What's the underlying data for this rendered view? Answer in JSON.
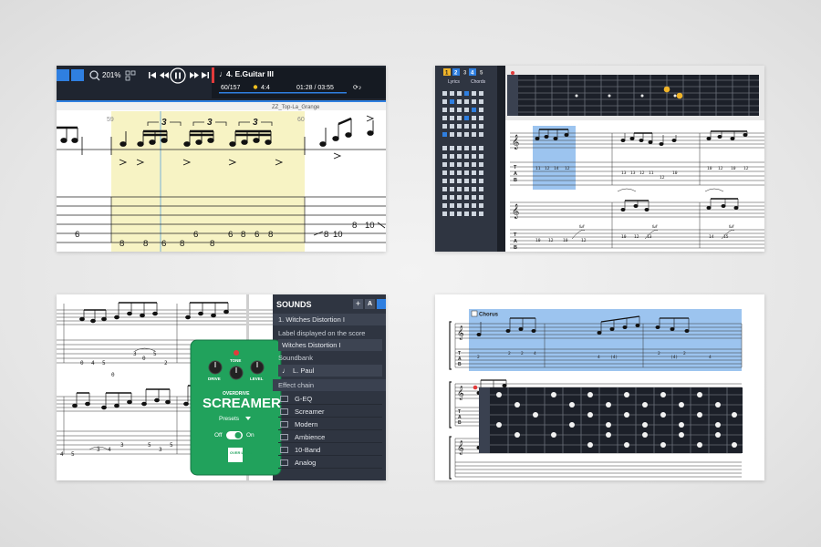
{
  "panel1": {
    "zoom": "201%",
    "track_name": "4. E.Guitar III",
    "bar_position": "60/157",
    "time_signature": "4:4",
    "time": "01:28 / 03:55",
    "song_title": "ZZ_Top-La_Grange",
    "bar_numbers": [
      "59",
      "60"
    ],
    "triplet_marks": [
      "3",
      "3",
      "3"
    ],
    "tab_numbers": [
      "6",
      "8",
      "8",
      "6",
      "8",
      "6",
      "8",
      "6",
      "8",
      "6",
      "8",
      "8",
      "10",
      "8",
      "10"
    ]
  },
  "panel2": {
    "palette_tabs": [
      "1",
      "2",
      "3",
      "4",
      "5"
    ],
    "lyrics_label": "Lyrics",
    "chords_label": "Chords",
    "tab_clef": [
      "T",
      "A",
      "B"
    ],
    "fret_row_1": [
      "11",
      "12",
      "14",
      "12",
      "13",
      "13",
      "12",
      "11",
      "12",
      "10",
      "10",
      "12",
      "10",
      "12"
    ],
    "fret_row_2": [
      "10",
      "12",
      "10",
      "12",
      "10",
      "12",
      "13",
      "14",
      "15"
    ],
    "bend_labels": [
      "full",
      "full",
      "full"
    ]
  },
  "panel3": {
    "sounds_title": "SOUNDS",
    "add_label": "+",
    "automation_label": "A",
    "track_item": "1. Witches Distortion I",
    "label_section": "Label displayed on the score",
    "label_value": "Witches Distortion I",
    "soundbank_section": "Soundbank",
    "soundbank_value": "L. Paul",
    "effect_chain_section": "Effect chain",
    "effects": [
      "G-EQ",
      "Screamer",
      "Modern",
      "Ambience",
      "10-Band",
      "Analog"
    ],
    "pedal": {
      "overdrive": "OVERDRIVE",
      "name": "SCREAMER",
      "knob_drive": "DRIVE",
      "knob_tone": "TONE",
      "knob_level": "LEVEL",
      "presets": "Presets",
      "off": "Off",
      "on": "On",
      "brand": "OVER LOUD"
    },
    "tab_numbers_top": [
      "0",
      "4",
      "5",
      "3",
      "0",
      "5",
      "2",
      "0",
      "3",
      "5",
      "0",
      "3",
      "0"
    ],
    "tab_numbers_bottom": [
      "4",
      "5",
      "3",
      "4",
      "3",
      "5",
      "3",
      "5",
      "3",
      "0",
      "4",
      "5"
    ]
  },
  "panel4": {
    "section_label": "Chorus",
    "tab_clef": [
      "T",
      "A",
      "B"
    ],
    "tab_numbers": [
      "2",
      "2",
      "2",
      "4",
      "4",
      "(4)",
      "2",
      "(4)",
      "2",
      "4"
    ]
  },
  "colors": {
    "toolbar_bg": "#1f2530",
    "highlight_yellow": "#f7f3c4",
    "selection_blue": "#9cc4ef",
    "pedal_green": "#21a25c",
    "dark_panel": "#2f3541",
    "accent_blue": "#2f7fe0"
  }
}
